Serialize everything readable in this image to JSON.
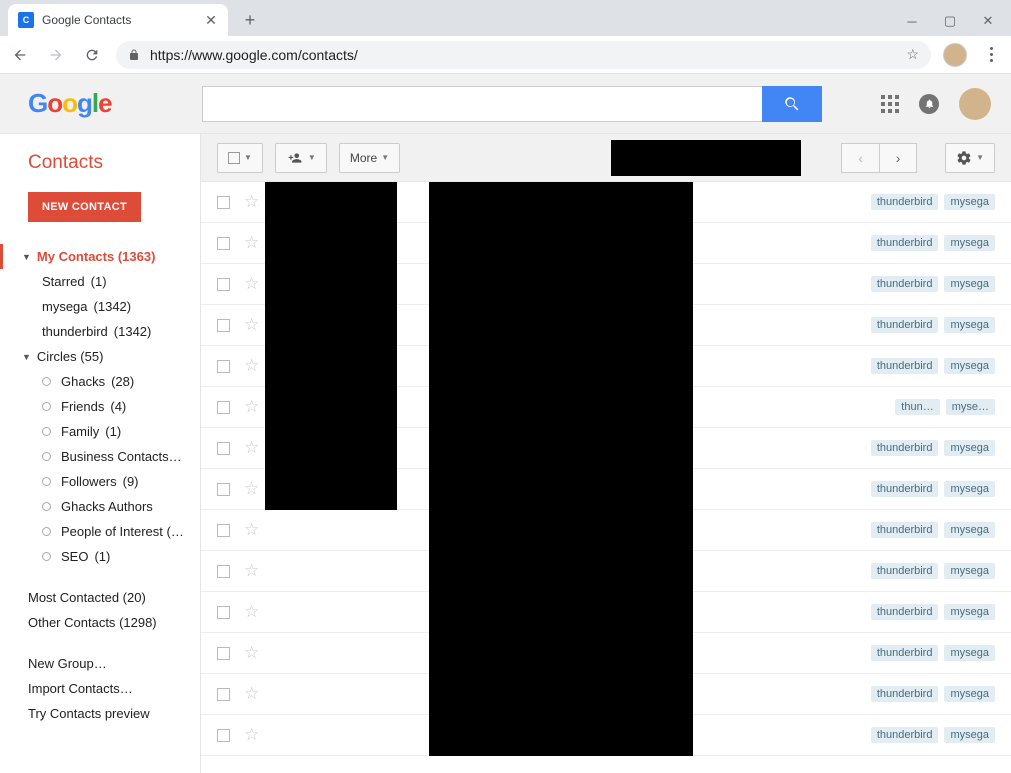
{
  "browser": {
    "tab_title": "Google Contacts",
    "url": "https://www.google.com/contacts/"
  },
  "app": {
    "title": "Contacts",
    "new_contact_label": "NEW CONTACT",
    "search_placeholder": ""
  },
  "sidebar": {
    "my_contacts": {
      "label": "My Contacts",
      "count": "(1363)"
    },
    "subgroups": [
      {
        "label": "Starred",
        "count": "(1)"
      },
      {
        "label": "mysega",
        "count": "(1342)"
      },
      {
        "label": "thunderbird",
        "count": "(1342)"
      }
    ],
    "circles": {
      "label": "Circles",
      "count": "(55)"
    },
    "circle_items": [
      {
        "label": "Ghacks",
        "count": "(28)"
      },
      {
        "label": "Friends",
        "count": "(4)"
      },
      {
        "label": "Family",
        "count": "(1)"
      },
      {
        "label": "Business Contacts…",
        "count": ""
      },
      {
        "label": "Followers",
        "count": "(9)"
      },
      {
        "label": "Ghacks Authors",
        "count": ""
      },
      {
        "label": "People of Interest (…",
        "count": ""
      },
      {
        "label": "SEO",
        "count": "(1)"
      }
    ],
    "most_contacted": {
      "label": "Most Contacted",
      "count": "(20)"
    },
    "other_contacts": {
      "label": "Other Contacts",
      "count": "(1298)"
    },
    "links": [
      "New Group…",
      "Import Contacts…",
      "Try Contacts preview"
    ]
  },
  "toolbar": {
    "more_label": "More"
  },
  "contacts": [
    {
      "tags": [
        "thunderbird",
        "mysega"
      ]
    },
    {
      "tags": [
        "thunderbird",
        "mysega"
      ]
    },
    {
      "tags": [
        "thunderbird",
        "mysega"
      ]
    },
    {
      "tags": [
        "thunderbird",
        "mysega"
      ]
    },
    {
      "tags": [
        "thunderbird",
        "mysega"
      ]
    },
    {
      "tags": [
        "thun…",
        "myse…"
      ]
    },
    {
      "tags": [
        "thunderbird",
        "mysega"
      ]
    },
    {
      "tags": [
        "thunderbird",
        "mysega"
      ]
    },
    {
      "tags": [
        "thunderbird",
        "mysega"
      ]
    },
    {
      "tags": [
        "thunderbird",
        "mysega"
      ]
    },
    {
      "tags": [
        "thunderbird",
        "mysega"
      ]
    },
    {
      "tags": [
        "thunderbird",
        "mysega"
      ]
    },
    {
      "tags": [
        "thunderbird",
        "mysega"
      ]
    },
    {
      "tags": [
        "thunderbird",
        "mysega"
      ]
    }
  ]
}
